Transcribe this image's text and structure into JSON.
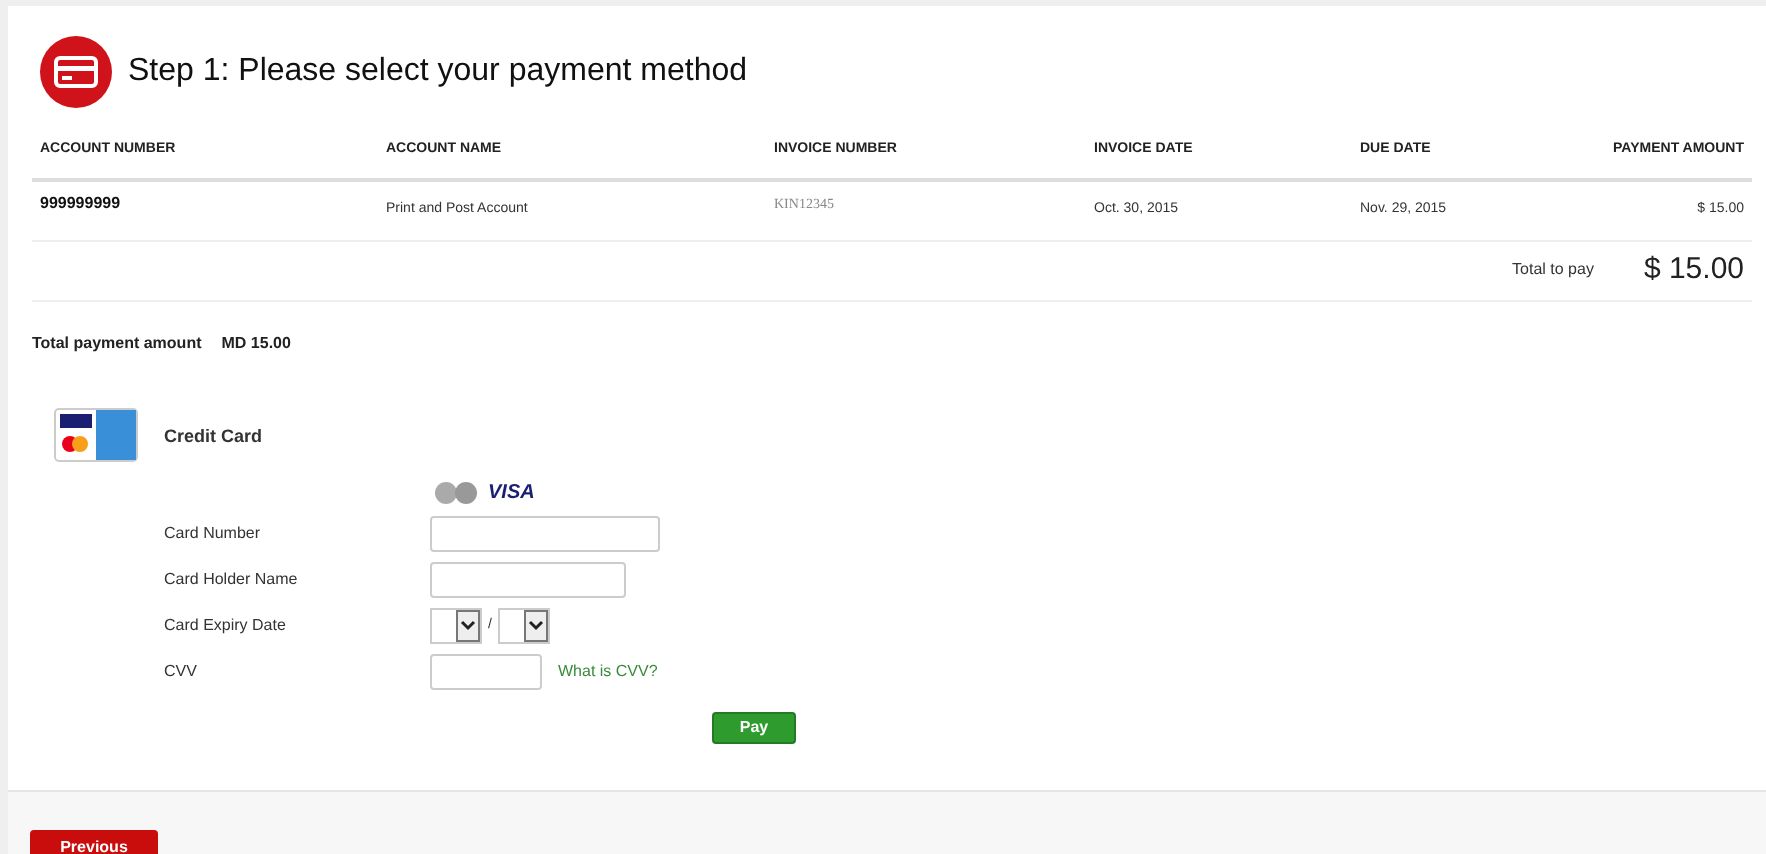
{
  "header": {
    "title": "Step 1: Please select your payment method"
  },
  "table": {
    "columns": [
      "ACCOUNT NUMBER",
      "ACCOUNT NAME",
      "INVOICE NUMBER",
      "INVOICE DATE",
      "DUE DATE",
      "PAYMENT AMOUNT"
    ],
    "rows": [
      [
        "999999999",
        "Print and Post Account",
        "KIN12345",
        "Oct. 30, 2015",
        "Nov. 29, 2015",
        "$ 15.00"
      ]
    ],
    "total_label": "Total to pay",
    "total_value": "$ 15.00"
  },
  "summary": {
    "label": "Total payment amount",
    "value": "MD 15.00"
  },
  "payment": {
    "method": "Credit Card",
    "visa_logo": "VISA",
    "fields": [
      {
        "kind": "text",
        "label": "Card Number"
      },
      {
        "kind": "text",
        "label": "Card Holder Name"
      },
      {
        "kind": "expiry",
        "label": "Card Expiry Date",
        "separator": "/"
      },
      {
        "kind": "cvv",
        "label": "CVV",
        "link": "What is CVV?"
      }
    ],
    "pay_button": "Pay"
  },
  "footer": {
    "previous_button": "Previous"
  }
}
